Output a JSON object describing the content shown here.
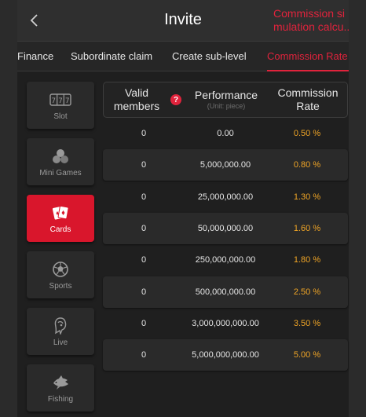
{
  "header": {
    "title": "Invite",
    "back_icon": "chevron-left-icon",
    "link_line1": "Commission si",
    "link_line2": "mulation calcu..."
  },
  "tabs": [
    {
      "label": "Finance",
      "active": false
    },
    {
      "label": "Subordinate claim",
      "active": false
    },
    {
      "label": "Create sub-level",
      "active": false
    },
    {
      "label": "Commission Rate",
      "active": true
    }
  ],
  "sidebar": {
    "items": [
      {
        "label": "Slot",
        "icon": "slot-machine-icon",
        "active": false
      },
      {
        "label": "Mini Games",
        "icon": "mini-games-icon",
        "active": false
      },
      {
        "label": "Cards",
        "icon": "cards-icon",
        "active": true
      },
      {
        "label": "Sports",
        "icon": "soccer-ball-icon",
        "active": false
      },
      {
        "label": "Live",
        "icon": "live-dealer-icon",
        "active": false
      },
      {
        "label": "Fishing",
        "icon": "fish-icon",
        "active": false
      }
    ]
  },
  "table": {
    "headers": {
      "valid_members": "Valid members",
      "performance": "Performance",
      "performance_unit": "(Unit: piece)",
      "commission_rate": "Commission Rate"
    },
    "help_symbol": "?",
    "rows": [
      {
        "members": "0",
        "performance": "0.00",
        "rate": "0.50 %"
      },
      {
        "members": "0",
        "performance": "5,000,000.00",
        "rate": "0.80 %"
      },
      {
        "members": "0",
        "performance": "25,000,000.00",
        "rate": "1.30 %"
      },
      {
        "members": "0",
        "performance": "50,000,000.00",
        "rate": "1.60 %"
      },
      {
        "members": "0",
        "performance": "250,000,000.00",
        "rate": "1.80 %"
      },
      {
        "members": "0",
        "performance": "500,000,000.00",
        "rate": "2.50 %"
      },
      {
        "members": "0",
        "performance": "3,000,000,000.00",
        "rate": "3.50 %"
      },
      {
        "members": "0",
        "performance": "5,000,000,000.00",
        "rate": "5.00 %"
      }
    ]
  },
  "colors": {
    "accent": "#e0233c",
    "rate": "#f0a526",
    "background": "#1f1f1f"
  }
}
